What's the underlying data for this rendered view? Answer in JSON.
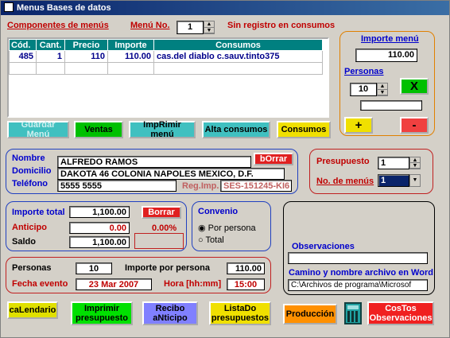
{
  "window": {
    "title": "Menus Bases de datos"
  },
  "header": {
    "componentes_label": "Componentes de menús",
    "menu_no_label": "Menú No.",
    "menu_no_value": "1",
    "status_text": "Sin registro en consumos"
  },
  "table": {
    "columns": [
      "Cód.",
      "Cant.",
      "Precio",
      "Importe",
      "Consumos"
    ],
    "rows": [
      [
        "485",
        "1",
        "110",
        "110.00",
        "cas.del diablo c.sauv.tinto375"
      ]
    ]
  },
  "importe_panel": {
    "label": "Importe menú",
    "value": "110.00",
    "personas_label": "Personas",
    "personas_value": "10",
    "x_label": "X",
    "plus_label": "+",
    "minus_label": "-"
  },
  "actions": {
    "guardar": "Guardar Menú",
    "ventas": "Ventas",
    "imprimir": "ImpRimir menú",
    "alta": "Alta consumos",
    "consumos": "Consumos"
  },
  "client": {
    "nombre_label": "Nombre",
    "nombre": "ALFREDO RAMOS",
    "borrar": "bOrrar",
    "domicilio_label": "Domicilio",
    "domicilio": "DAKOTA 46 COLONIA NAPOLES MEXICO, D.F.",
    "telefono_label": "Teléfono",
    "telefono": "5555 5555",
    "regimp_label": "Reg.Imp.",
    "regimp": "SES-151245-KI6"
  },
  "presupuesto": {
    "label": "Presupuesto",
    "value": "1",
    "no_menus_label": "No. de menús",
    "no_menus_value": "1"
  },
  "totals": {
    "importe_total_label": "Importe total",
    "importe_total": "1,100.00",
    "borrar": "Borrar",
    "anticipo_label": "Anticipo",
    "anticipo": "0.00",
    "pct": "0.00%",
    "saldo_label": "Saldo",
    "saldo": "1,100.00"
  },
  "convenio": {
    "label": "Convenio",
    "opt1": "Por persona",
    "opt2": "Total",
    "selected": "Por persona"
  },
  "observ": {
    "label": "Observaciones",
    "value": "",
    "path_label": "Camino y nombre archivo en Word",
    "path": "C:\\Archivos de programa\\Microsof"
  },
  "event": {
    "personas_label": "Personas",
    "personas": "10",
    "ipp_label": "Importe por persona",
    "ipp": "110.00",
    "fecha_label": "Fecha evento",
    "fecha": "23 Mar 2007",
    "hora_label": "Hora [hh:mm]",
    "hora": "15:00"
  },
  "bottom": {
    "calendario": "caLendario",
    "imprimir1": "Imprimir",
    "imprimir2": "presupuesto",
    "recibo1": "Recibo",
    "recibo2": "aNticipo",
    "lista1": "ListaDo",
    "lista2": "presupuestos",
    "produccion": "Producción",
    "costos1": "CosTos",
    "costos2": "Observaciones"
  }
}
